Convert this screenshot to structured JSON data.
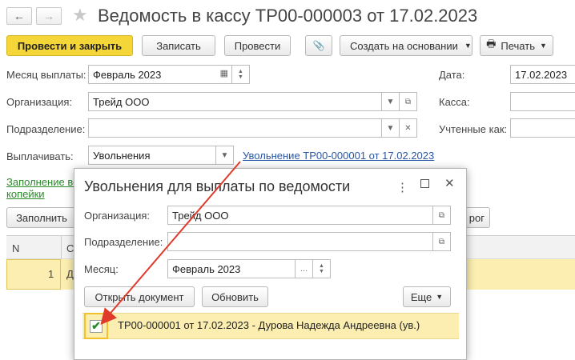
{
  "window": {
    "title": "Ведомость в кассу ТР00-000003 от 17.02.2023"
  },
  "nav": {
    "back_icon": "←",
    "forward_icon": "→",
    "star_icon": "★"
  },
  "toolbar": {
    "post_close": "Провести и закрыть",
    "save": "Записать",
    "post": "Провести",
    "attach_icon": "📎",
    "create_based": "Создать на основании",
    "print": "Печать"
  },
  "form": {
    "month_label": "Месяц выплаты:",
    "month_value": "Февраль 2023",
    "org_label": "Организация:",
    "org_value": "Трейд ООО",
    "dept_label": "Подразделение:",
    "dept_value": "",
    "pay_label": "Выплачивать:",
    "pay_value": "Увольнения",
    "pay_link": "Увольнение ТР00-000001 от 17.02.2023",
    "date_label": "Дата:",
    "date_value": "17.02.2023",
    "cash_label": "Касса:",
    "counted_label": "Учтенные как:",
    "fill_link_1": "Заполнение ве",
    "fill_link_2": "копейки",
    "fill_button": "Заполнить",
    "right_button_tail": "рог"
  },
  "table": {
    "col_n": "N",
    "col_c": "С",
    "row1_n": "1",
    "row1_c": "Д"
  },
  "dialog": {
    "title": "Увольнения для выплаты по ведомости",
    "org_label": "Организация:",
    "org_value": "Трейд ООО",
    "dept_label": "Подразделение:",
    "dept_value": "",
    "month_label": "Месяц:",
    "month_value": "Февраль 2023",
    "open_doc": "Открыть документ",
    "refresh": "Обновить",
    "more": "Еще",
    "row_text": "ТР00-000001 от 17.02.2023 - Дурова Надежда Андреевна (ув.)"
  },
  "colors": {
    "accent": "#f5d638",
    "selection": "#fbeeb0",
    "link": "#2a56a6",
    "arrow": "#e03a2a"
  }
}
